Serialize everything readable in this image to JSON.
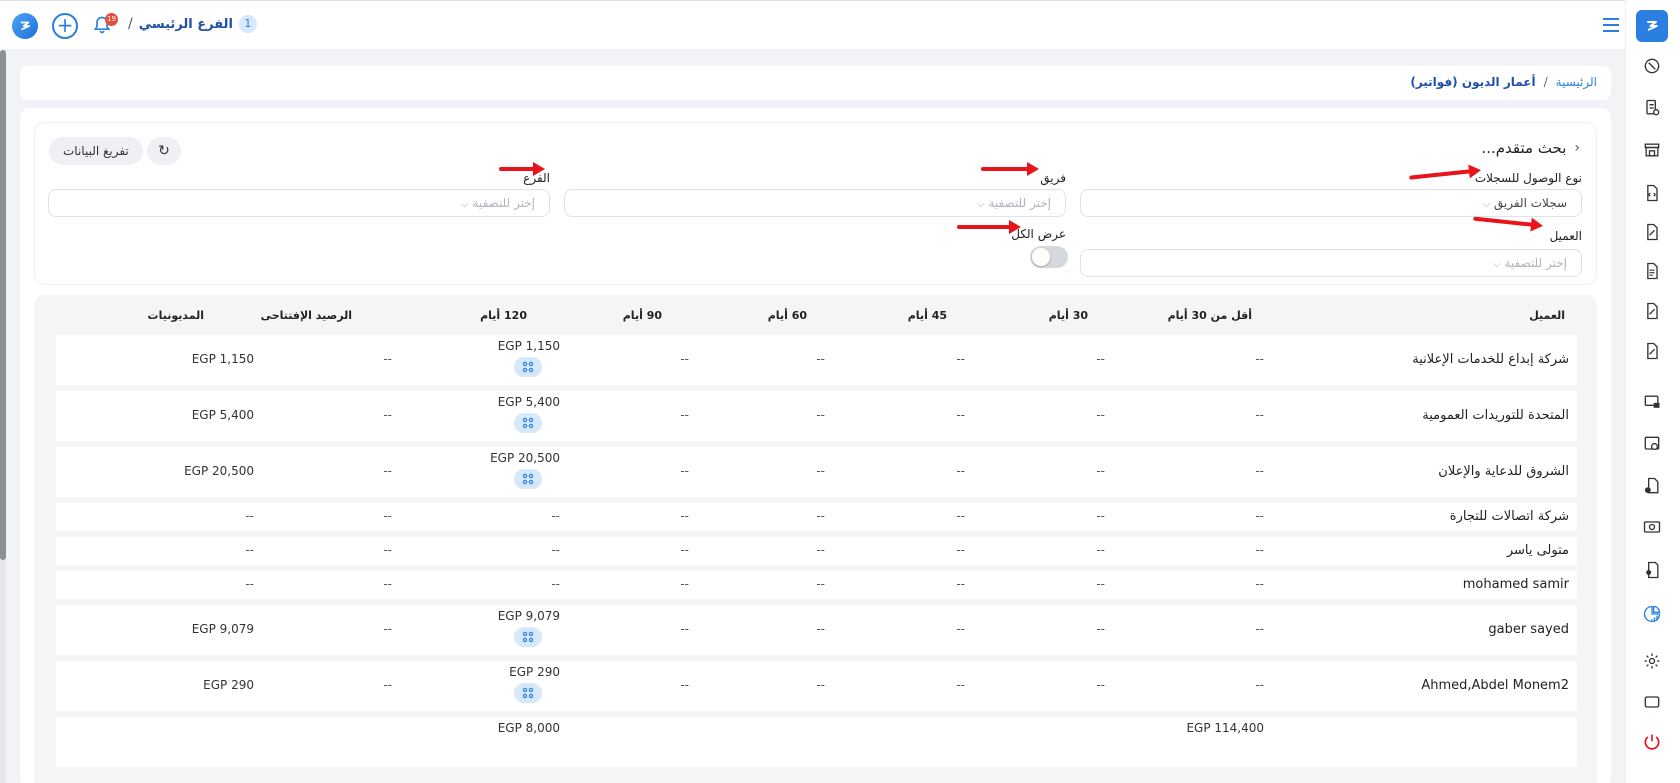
{
  "topbar": {
    "branch_number": "1",
    "branch_name": "الفرع الرئيسي",
    "separator": "/",
    "notification_count": "19"
  },
  "breadcrumb": {
    "home": "الرئيسية",
    "sep": "/",
    "current": "أعمار الديون (فواتير)"
  },
  "filters": {
    "title": "بحث متقدم...",
    "export_label": "تفريغ البيانات",
    "records_access_label": "نوع الوصول للسجلات",
    "records_access_value": "سجلات الفريق",
    "team_label": "فريق",
    "team_placeholder": "إختر للتصفية",
    "branch_label": "الفرع",
    "branch_placeholder": "إختر للتصفية",
    "client_label": "العميل",
    "client_placeholder": "إختر للتصفية",
    "show_all_label": "عرض الكل"
  },
  "table": {
    "headers": {
      "client": "العميل",
      "lt30": "أقل من 30 أيام",
      "d30": "30 أيام",
      "d45": "45 أيام",
      "d60": "60 أيام",
      "d90": "90 أيام",
      "d120": "120 أيام",
      "opening": "الرصيد الإفتتاحى",
      "debts": "المديونيات"
    },
    "rows": [
      {
        "client": "شركة إبداع للخدمات الإعلانية",
        "lt30": "--",
        "d30": "--",
        "d45": "--",
        "d60": "--",
        "d90": "--",
        "d120": "EGP 1,150",
        "opening": "--",
        "debts": "EGP 1,150"
      },
      {
        "client": "المتحدة للتوريدات العمومية",
        "lt30": "--",
        "d30": "--",
        "d45": "--",
        "d60": "--",
        "d90": "--",
        "d120": "EGP 5,400",
        "opening": "--",
        "debts": "EGP 5,400"
      },
      {
        "client": "الشروق للدعاية والإعلان",
        "lt30": "--",
        "d30": "--",
        "d45": "--",
        "d60": "--",
        "d90": "--",
        "d120": "EGP 20,500",
        "opening": "--",
        "debts": "EGP 20,500"
      },
      {
        "client": "شركة اتصالات للتجارة",
        "lt30": "--",
        "d30": "--",
        "d45": "--",
        "d60": "--",
        "d90": "--",
        "d120": "--",
        "opening": "--",
        "debts": "--"
      },
      {
        "client": "متولى ياسر",
        "lt30": "--",
        "d30": "--",
        "d45": "--",
        "d60": "--",
        "d90": "--",
        "d120": "--",
        "opening": "--",
        "debts": "--"
      },
      {
        "client": "mohamed samir",
        "lt30": "--",
        "d30": "--",
        "d45": "--",
        "d60": "--",
        "d90": "--",
        "d120": "--",
        "opening": "--",
        "debts": "--"
      },
      {
        "client": "gaber sayed",
        "lt30": "--",
        "d30": "--",
        "d45": "--",
        "d60": "--",
        "d90": "--",
        "d120": "EGP 9,079",
        "opening": "--",
        "debts": "EGP 9,079"
      },
      {
        "client": "Ahmed,Abdel Monem2",
        "lt30": "--",
        "d30": "--",
        "d45": "--",
        "d60": "--",
        "d90": "--",
        "d120": "EGP 290",
        "opening": "--",
        "debts": "EGP 290"
      },
      {
        "client": "",
        "lt30": "EGP 114,400",
        "d30": "",
        "d45": "",
        "d60": "",
        "d90": "",
        "d120": "EGP 8,000",
        "opening": "",
        "debts": ""
      }
    ]
  }
}
